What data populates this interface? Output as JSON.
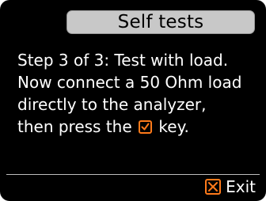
{
  "title": "Self tests",
  "message": {
    "line1": "Step 3 of 3: Test with load.",
    "line2": "Now connect a 50 Ohm load",
    "line3": "directly to the analyzer,",
    "line4_before": "then press the",
    "line4_after": "key."
  },
  "icons": {
    "ok_key": "checkmark-icon",
    "exit_key": "x-icon"
  },
  "softkey": {
    "exit_label": "Exit"
  },
  "colors": {
    "background": "#000000",
    "title_bar": "#c8c8c8",
    "accent": "#ff7a1a",
    "text": "#ffffff"
  }
}
